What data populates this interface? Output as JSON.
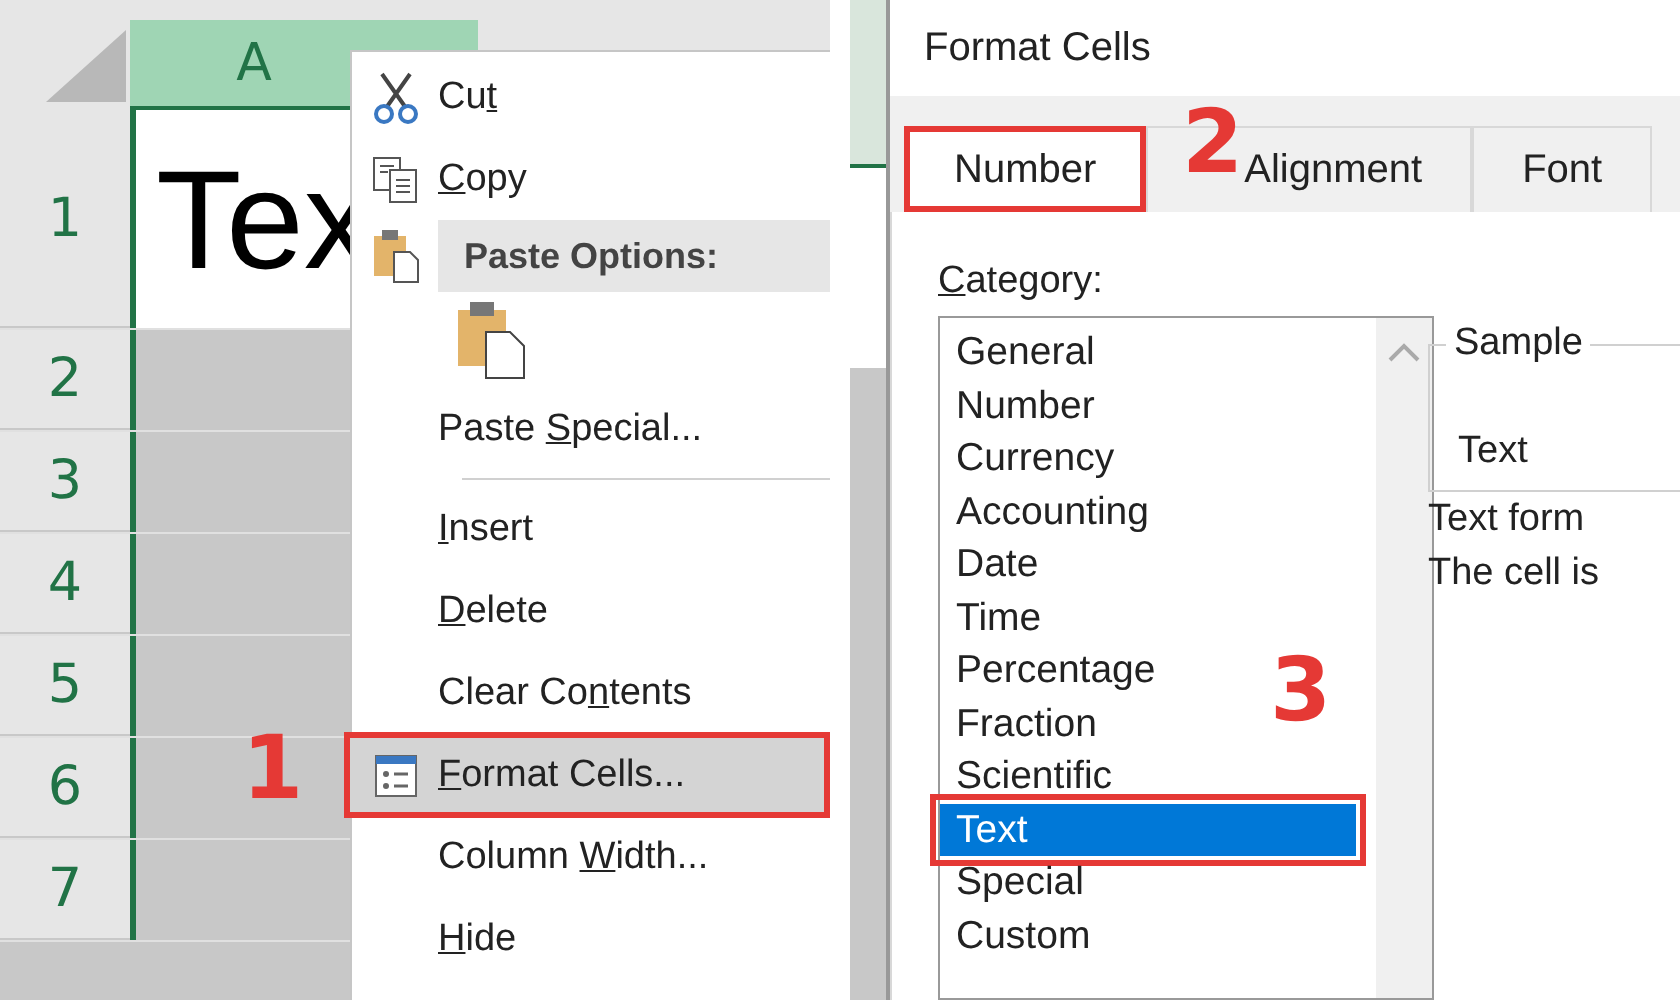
{
  "sheet": {
    "column_header": "A",
    "cell_text": "Tex",
    "rows": [
      {
        "number": "1"
      },
      {
        "number": "2"
      },
      {
        "number": "3"
      },
      {
        "number": "4"
      },
      {
        "number": "5"
      },
      {
        "number": "6"
      },
      {
        "number": "7"
      }
    ]
  },
  "context_menu": {
    "items": [
      {
        "kind": "cut",
        "before": "Cu",
        "key": "t",
        "selected": false
      },
      {
        "kind": "copy",
        "key": "C",
        "after": "opy",
        "selected": false
      },
      {
        "kind": "header",
        "label": "Paste Options:"
      },
      {
        "kind": "paste-options"
      },
      {
        "kind": "item",
        "before": "Paste ",
        "key": "S",
        "after": "pecial...",
        "selected": false
      },
      {
        "kind": "separator"
      },
      {
        "kind": "item",
        "key": "I",
        "after": "nsert",
        "selected": false
      },
      {
        "kind": "item",
        "key": "D",
        "after": "elete",
        "selected": false
      },
      {
        "kind": "item",
        "before": "Clear Co",
        "key": "n",
        "after": "tents",
        "selected": false
      },
      {
        "kind": "format",
        "key": "F",
        "after": "ormat Cells...",
        "selected": true,
        "callout": "1"
      },
      {
        "kind": "item",
        "before": "Column ",
        "key": "W",
        "after": "idth...",
        "selected": false
      },
      {
        "kind": "item",
        "key": "H",
        "after": "ide",
        "selected": false
      }
    ]
  },
  "dialog": {
    "title": "Format Cells",
    "tabs": [
      {
        "label": "Number",
        "selected": true,
        "callout": "2"
      },
      {
        "label": "Alignment",
        "selected": false
      },
      {
        "label": "Font",
        "selected": false
      }
    ],
    "category_label_key": "C",
    "category_label_rest": "ategory:",
    "categories": [
      {
        "label": "General",
        "selected": false
      },
      {
        "label": "Number",
        "selected": false
      },
      {
        "label": "Currency",
        "selected": false
      },
      {
        "label": "Accounting",
        "selected": false
      },
      {
        "label": "Date",
        "selected": false
      },
      {
        "label": "Time",
        "selected": false
      },
      {
        "label": "Percentage",
        "selected": false
      },
      {
        "label": "Fraction",
        "selected": false
      },
      {
        "label": "Scientific",
        "selected": false
      },
      {
        "label": "Text",
        "selected": true,
        "callout": "3"
      },
      {
        "label": "Special",
        "selected": false
      },
      {
        "label": "Custom",
        "selected": false
      }
    ],
    "sample_label": "Sample",
    "sample_value": "Text",
    "description": [
      "Text form",
      "The cell is"
    ]
  }
}
